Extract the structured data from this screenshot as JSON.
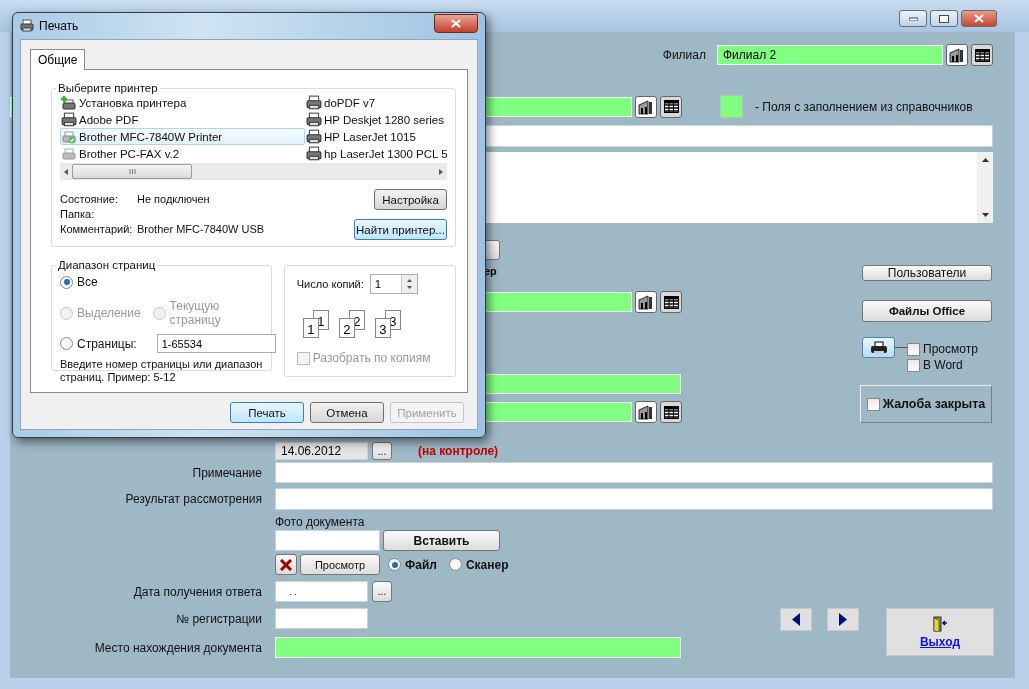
{
  "main_window": {
    "branch": {
      "label": "Филиал",
      "value": "Филиал 2"
    },
    "legend": "-  Поля с заполнением из справочников",
    "hidden_fragment": "ер",
    "side_buttons": [
      "Пользователи",
      "Файлы Office"
    ],
    "print_options": [
      {
        "label": "Просмотр",
        "checked": false
      },
      {
        "label": "В Word",
        "checked": false
      }
    ],
    "complaint_closed": {
      "label": "Жалоба закрыта",
      "checked": false
    },
    "control_date": {
      "value": "14.06.2012",
      "picker": "...",
      "note": "(на контроле)"
    },
    "note_label": "Примечание",
    "result_label": "Результат рассмотрения",
    "photo": {
      "label": "Фото документа",
      "insert": "Вставить",
      "view": "Просмотр",
      "sources": [
        {
          "label": "Файл",
          "selected": true
        },
        {
          "label": "Сканер",
          "selected": false
        }
      ]
    },
    "answer_date": {
      "label": "Дата получения ответа",
      "value": ". .",
      "picker": "..."
    },
    "registration_label": "№ регистрации",
    "location_label": "Место нахождения документа",
    "exit": "Выход"
  },
  "print_dialog": {
    "title": "Печать",
    "tabs": [
      {
        "label": "Общие",
        "selected": true
      }
    ],
    "printer_group": "Выберите принтер",
    "printers": [
      {
        "name": "Установка принтера",
        "kind": "add",
        "selected": false
      },
      {
        "name": "Adobe PDF",
        "kind": "printer",
        "selected": false
      },
      {
        "name": "Brother MFC-7840W Printer",
        "kind": "default",
        "selected": true
      },
      {
        "name": "Brother PC-FAX v.2",
        "kind": "fax",
        "selected": false
      },
      {
        "name": "doPDF v7",
        "kind": "printer",
        "selected": false
      },
      {
        "name": "HP Deskjet 1280 series",
        "kind": "printer",
        "selected": false
      },
      {
        "name": "HP LaserJet 1015",
        "kind": "printer",
        "selected": false
      },
      {
        "name": "hp LaserJet 1300 PCL 5",
        "kind": "printer",
        "selected": false
      }
    ],
    "status": [
      {
        "label": "Состояние:",
        "value": "Не подключен"
      },
      {
        "label": "Папка:"
      },
      {
        "label": "Комментарий:",
        "value": "Brother MFC-7840W USB"
      }
    ],
    "setup_button": "Настройка",
    "find_button": "Найти принтер...",
    "range_group": "Диапазон страниц",
    "range_options": [
      {
        "label": "Все",
        "selected": true,
        "disabled": false
      },
      {
        "label": "Выделение",
        "selected": false,
        "disabled": true
      },
      {
        "label": "Текущую страницу",
        "selected": false,
        "disabled": true
      },
      {
        "label": "Страницы:",
        "selected": false,
        "disabled": false,
        "value": "1-65534"
      }
    ],
    "range_hint": "Введите номер страницы или диапазон страниц.  Пример: 5-12",
    "copies_label": "Число копий:",
    "copies_value": "1",
    "collate_pages": [
      {
        "back": "1",
        "front": "1"
      },
      {
        "back": "2",
        "front": "2"
      },
      {
        "back": "3",
        "front": "3"
      }
    ],
    "collate": {
      "label": "Разобрать по копиям",
      "checked": false,
      "disabled": true
    },
    "buttons": [
      {
        "label": "Печать",
        "disabled": false,
        "default": true
      },
      {
        "label": "Отмена",
        "disabled": false,
        "default": false
      },
      {
        "label": "Применить",
        "disabled": true,
        "default": false
      }
    ]
  }
}
